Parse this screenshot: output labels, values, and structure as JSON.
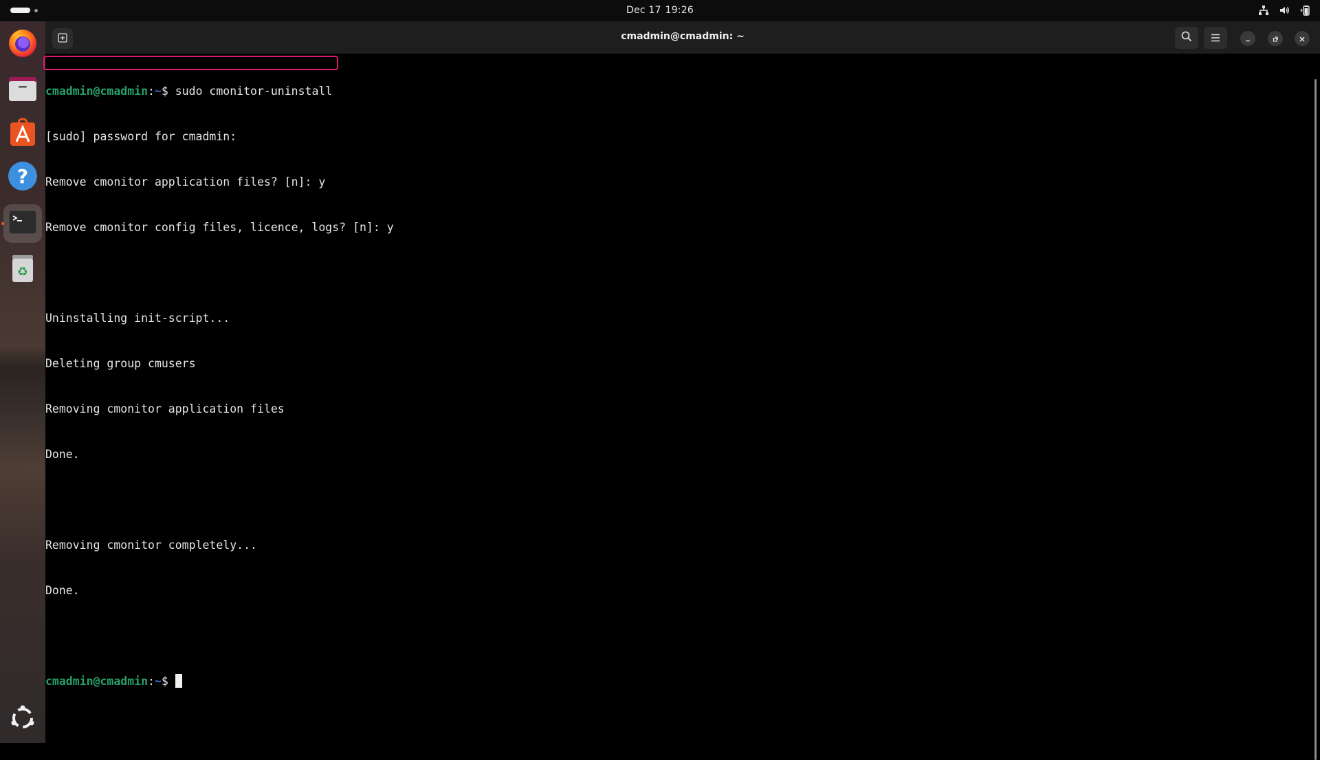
{
  "topbar": {
    "date": "Dec 17",
    "time": "19:26",
    "icons": [
      "network-icon",
      "volume-icon",
      "battery-icon"
    ]
  },
  "dock": {
    "items": [
      "firefox-icon",
      "files-icon",
      "app-center-icon",
      "help-icon",
      "terminal-icon",
      "trash-icon"
    ],
    "bottom": "show-apps-icon"
  },
  "window": {
    "title": "cmadmin@cmadmin: ~"
  },
  "terminal": {
    "user_host": "cmadmin@cmadmin",
    "separator": ":",
    "path": "~",
    "prompt_symbol": "$ ",
    "command": "sudo cmonitor-uninstall",
    "output": [
      "[sudo] password for cmadmin:",
      "Remove cmonitor application files? [n]: y",
      "Remove cmonitor config files, licence, logs? [n]: y",
      "",
      "Uninstalling init-script...",
      "Deleting group cmusers",
      "Removing cmonitor application files",
      "Done.",
      "",
      "Removing cmonitor completely...",
      "Done.",
      ""
    ]
  },
  "colors": {
    "prompt_user": "#26a269",
    "prompt_path": "#3b6fd4",
    "highlight": "#e2196f"
  }
}
